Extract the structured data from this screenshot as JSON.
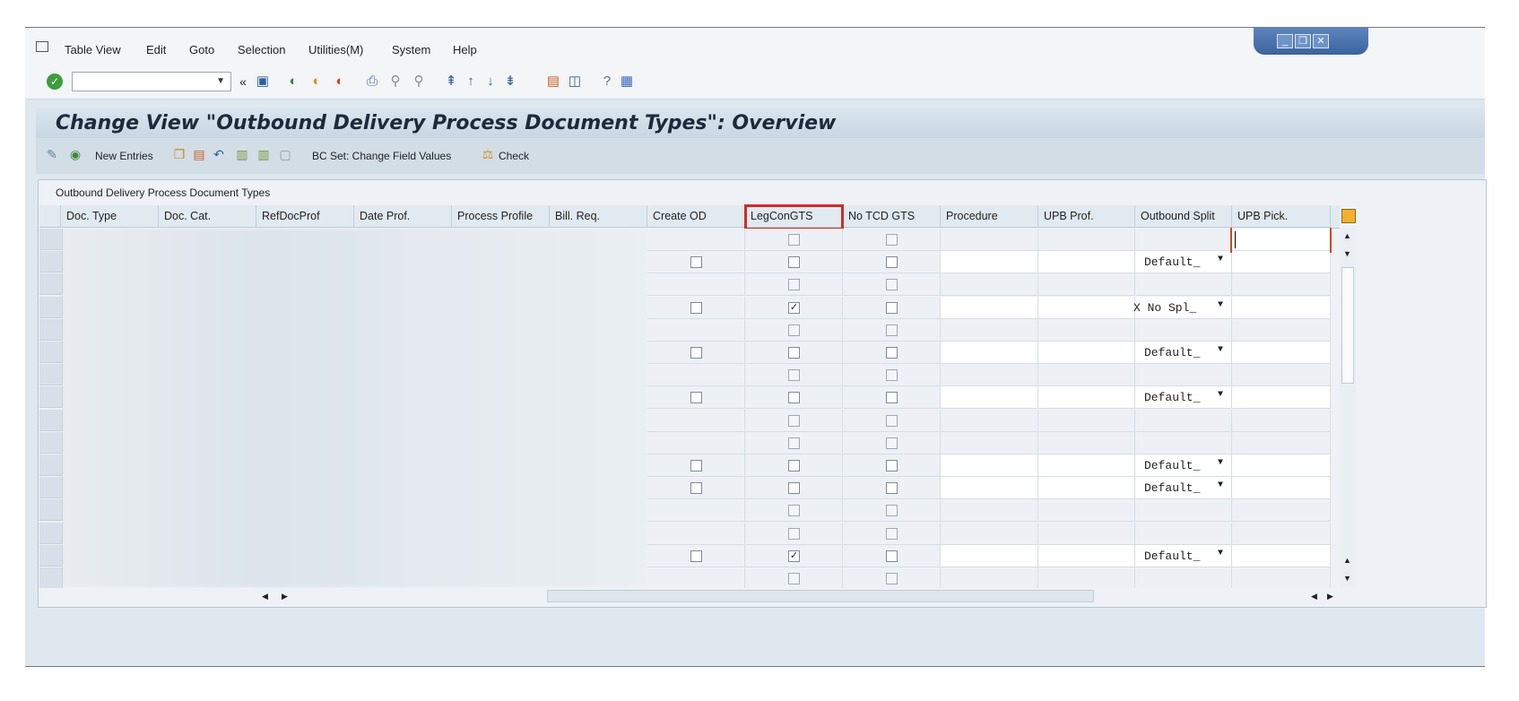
{
  "menu": [
    "Table View",
    "Edit",
    "Goto",
    "Selection",
    "Utilities(M)",
    "System",
    "Help"
  ],
  "toolbar": {
    "command_value": ""
  },
  "title": "Change View \"Outbound Delivery Process Document Types\": Overview",
  "app_toolbar": {
    "new_entries": "New Entries",
    "bc_set": "BC Set: Change Field Values",
    "check": "Check"
  },
  "panel_title": "Outbound Delivery Process Document Types",
  "columns": [
    "Doc. Type",
    "Doc. Cat.",
    "RefDocProf",
    "Date Prof.",
    "Process Profile",
    "Bill. Req.",
    "Create OD",
    "LegConGTS",
    "No TCD GTS",
    "Procedure",
    "UPB Prof.",
    "Outbound Split",
    "UPB Pick."
  ],
  "highlighted_column": "LegConGTS",
  "rows": [
    {
      "editable": false,
      "create_od": false,
      "legcon": false,
      "notcd": false,
      "outbound_split": ""
    },
    {
      "editable": true,
      "create_od": false,
      "legcon": false,
      "notcd": false,
      "outbound_split": "Default_"
    },
    {
      "editable": false,
      "create_od": false,
      "legcon": false,
      "notcd": false,
      "outbound_split": ""
    },
    {
      "editable": true,
      "create_od": false,
      "legcon": true,
      "notcd": false,
      "outbound_split": "X No Spl_"
    },
    {
      "editable": false,
      "create_od": false,
      "legcon": false,
      "notcd": false,
      "outbound_split": ""
    },
    {
      "editable": true,
      "create_od": false,
      "legcon": false,
      "notcd": false,
      "outbound_split": "Default_"
    },
    {
      "editable": false,
      "create_od": false,
      "legcon": false,
      "notcd": false,
      "outbound_split": ""
    },
    {
      "editable": true,
      "create_od": false,
      "legcon": false,
      "notcd": false,
      "outbound_split": "Default_"
    },
    {
      "editable": false,
      "create_od": false,
      "legcon": false,
      "notcd": false,
      "outbound_split": ""
    },
    {
      "editable": false,
      "create_od": false,
      "legcon": false,
      "notcd": false,
      "outbound_split": ""
    },
    {
      "editable": true,
      "create_od": false,
      "legcon": false,
      "notcd": false,
      "outbound_split": "Default_"
    },
    {
      "editable": true,
      "create_od": false,
      "legcon": false,
      "notcd": false,
      "outbound_split": "Default_"
    },
    {
      "editable": false,
      "create_od": false,
      "legcon": false,
      "notcd": false,
      "outbound_split": ""
    },
    {
      "editable": false,
      "create_od": false,
      "legcon": false,
      "notcd": false,
      "outbound_split": ""
    },
    {
      "editable": true,
      "create_od": false,
      "legcon": true,
      "notcd": false,
      "outbound_split": "Default_"
    },
    {
      "editable": false,
      "create_od": false,
      "legcon": false,
      "notcd": false,
      "outbound_split": ""
    }
  ],
  "icons": [
    "enter-icon",
    "save-icon",
    "back-icon",
    "exit-icon",
    "cancel-icon",
    "print-icon",
    "find-icon",
    "find-next-icon",
    "first-page-icon",
    "previous-page-icon",
    "next-page-icon",
    "last-page-icon",
    "new-session-icon",
    "shortcut-icon",
    "help-icon",
    "customize-layout-icon"
  ]
}
